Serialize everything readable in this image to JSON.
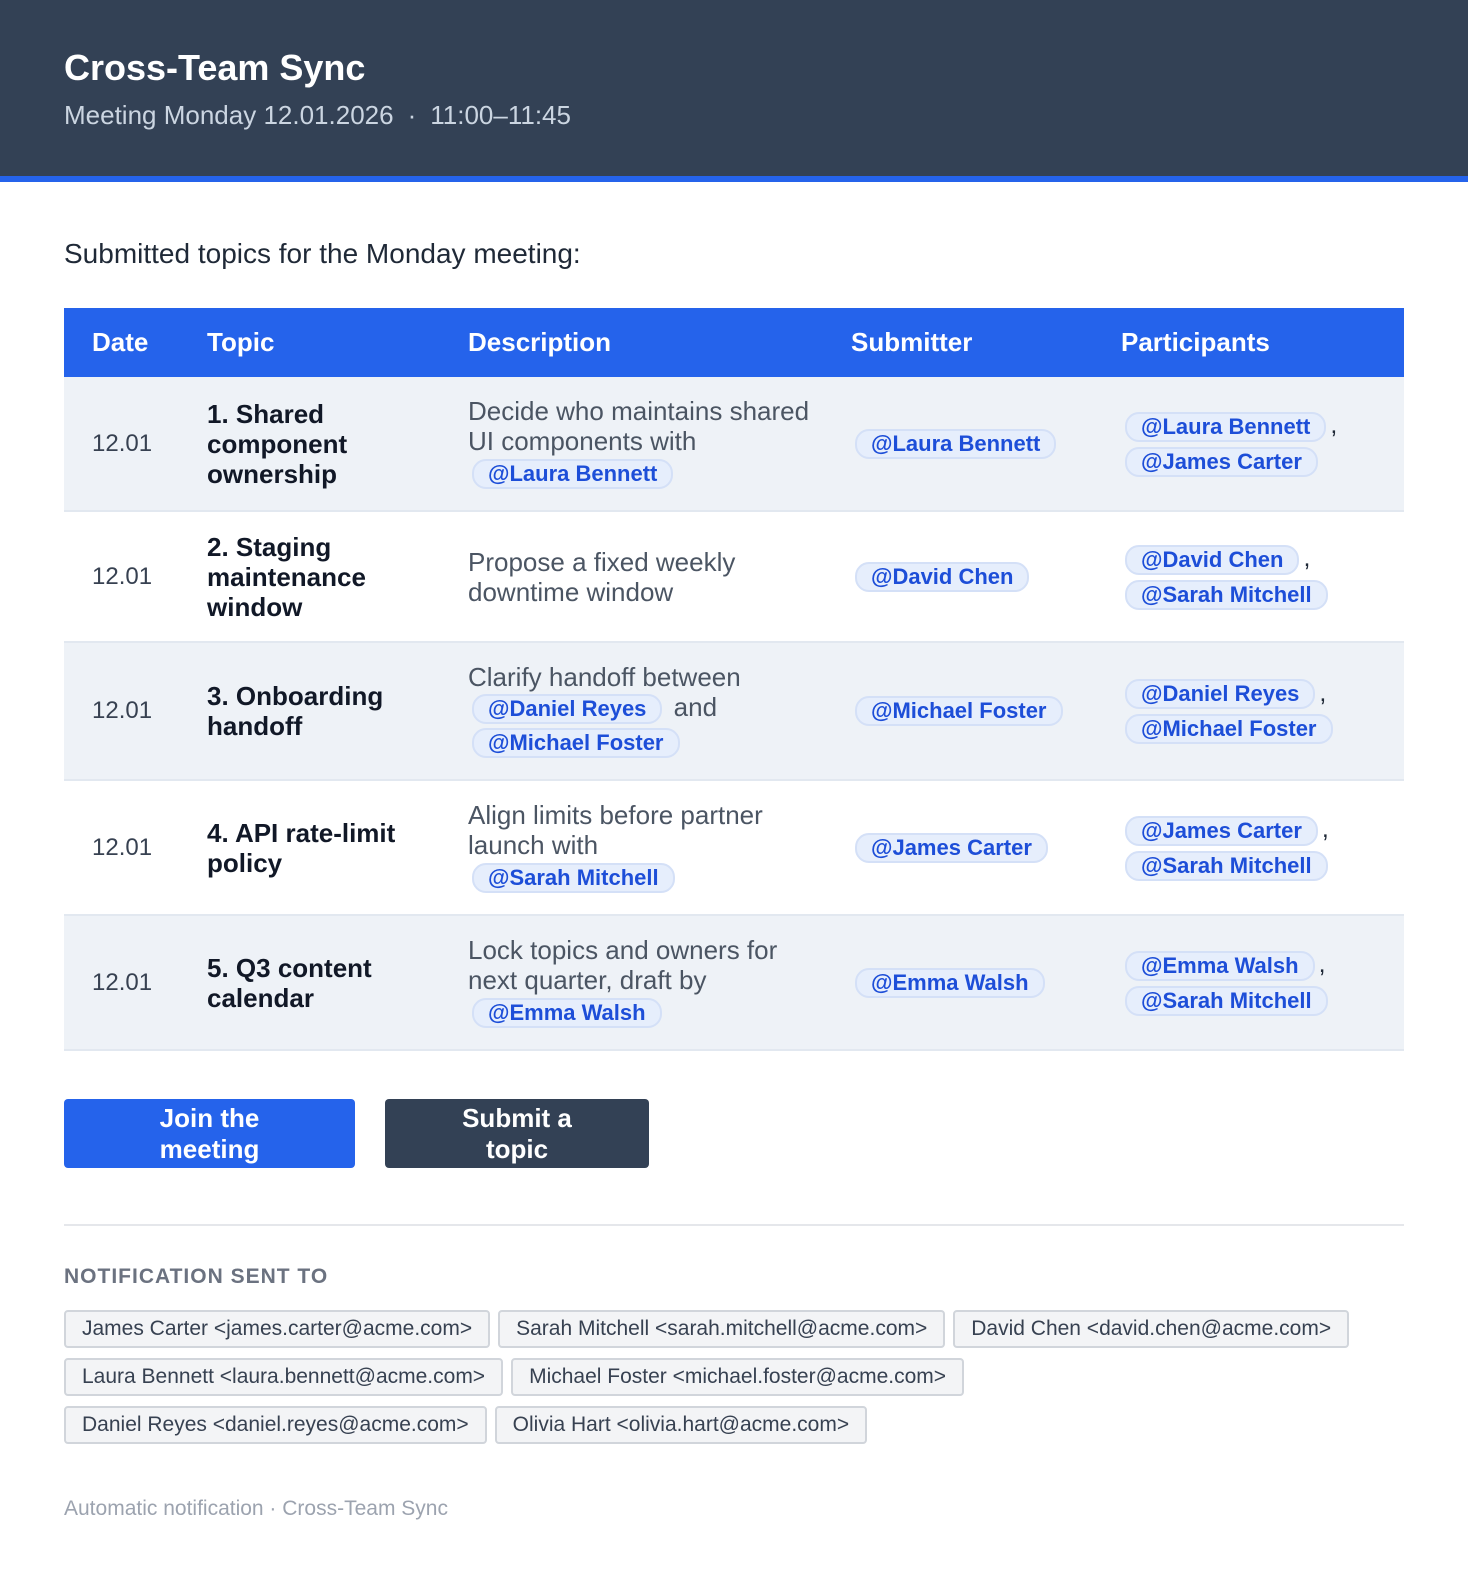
{
  "header": {
    "title": "Cross-Team Sync",
    "subtitle_date": "Meeting Monday 12.01.2026",
    "subtitle_sep": "·",
    "subtitle_time": "11:00–11:45"
  },
  "intro": "Submitted topics for the Monday meeting:",
  "table": {
    "headers": [
      "Date",
      "Topic",
      "Description",
      "Submitter",
      "Participants"
    ],
    "rows": [
      {
        "date": "12.01",
        "topic": "1. Shared component ownership",
        "desc_parts": [
          "Decide who maintains shared UI components with"
        ],
        "desc_mentions": [
          "@Laura Bennett"
        ],
        "submitter": "@Laura Bennett",
        "participants": [
          "@Laura Bennett",
          "@James Carter"
        ]
      },
      {
        "date": "12.01",
        "topic": "2. Staging maintenance window",
        "desc_parts": [
          "Propose a fixed weekly downtime window"
        ],
        "desc_mentions": [],
        "submitter": "@David Chen",
        "participants": [
          "@David Chen",
          "@Sarah Mitchell"
        ]
      },
      {
        "date": "12.01",
        "topic": "3. Onboarding handoff",
        "desc_parts": [
          "Clarify handoff between",
          "and"
        ],
        "desc_mentions": [
          "@Daniel Reyes",
          "@Michael Foster"
        ],
        "submitter": "@Michael Foster",
        "participants": [
          "@Daniel Reyes",
          "@Michael Foster"
        ]
      },
      {
        "date": "12.01",
        "topic": "4. API rate-limit policy",
        "desc_parts": [
          "Align limits before partner launch with"
        ],
        "desc_mentions": [
          "@Sarah Mitchell"
        ],
        "submitter": "@James Carter",
        "participants": [
          "@James Carter",
          "@Sarah Mitchell"
        ]
      },
      {
        "date": "12.01",
        "topic": "5. Q3 content calendar",
        "desc_parts": [
          "Lock topics and owners for next quarter, draft by"
        ],
        "desc_mentions": [
          "@Emma Walsh"
        ],
        "submitter": "@Emma Walsh",
        "participants": [
          "@Emma Walsh",
          "@Sarah Mitchell"
        ]
      }
    ]
  },
  "buttons": {
    "join": "Join the meeting",
    "submit": "Submit a topic"
  },
  "notification": {
    "title": "NOTIFICATION SENT TO",
    "recipients": [
      "James Carter <james.carter@acme.com>",
      "Sarah Mitchell <sarah.mitchell@acme.com>",
      "David Chen <david.chen@acme.com>",
      "Laura Bennett <laura.bennett@acme.com>",
      "Michael Foster <michael.foster@acme.com>",
      "Daniel Reyes <daniel.reyes@acme.com>",
      "Olivia Hart <olivia.hart@acme.com>"
    ]
  },
  "footer": "Automatic notification · Cross-Team Sync",
  "colors": {
    "header_bg": "#334155",
    "accent": "#2563eb",
    "mention_bg": "#e6eefc",
    "mention_text": "#1d4ed8"
  }
}
